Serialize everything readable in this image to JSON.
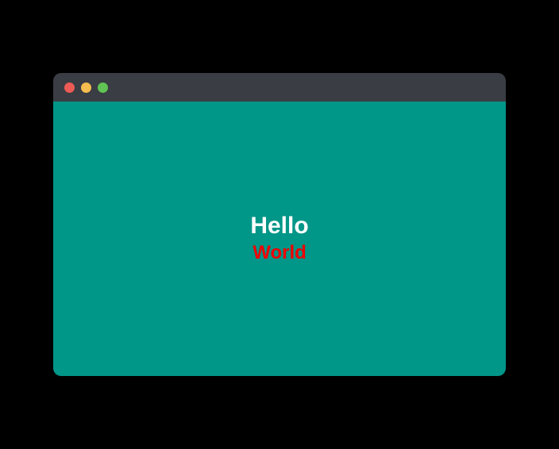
{
  "content": {
    "line1": "Hello",
    "line2": "World"
  },
  "colors": {
    "background": "#009688",
    "line1_color": "#ffffff",
    "line2_color": "#f00000"
  }
}
